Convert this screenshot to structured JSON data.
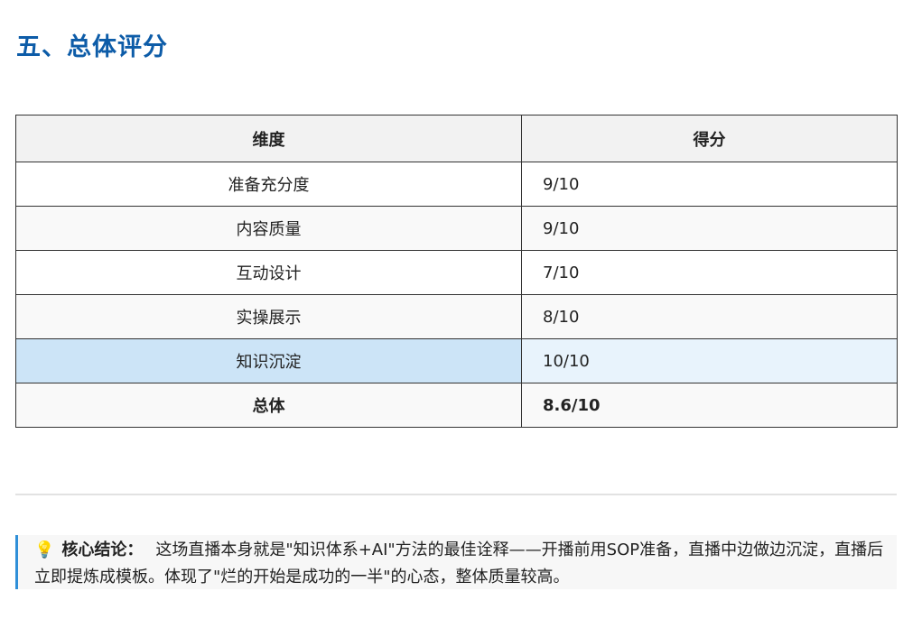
{
  "section": {
    "title": "五、总体评分"
  },
  "table": {
    "headers": [
      "维度",
      "得分"
    ],
    "rows": [
      {
        "dimension": "准备充分度",
        "score": "9/10"
      },
      {
        "dimension": "内容质量",
        "score": "9/10"
      },
      {
        "dimension": "互动设计",
        "score": "7/10"
      },
      {
        "dimension": "实操展示",
        "score": "8/10"
      },
      {
        "dimension": "知识沉淀",
        "score": "10/10"
      },
      {
        "dimension": "总体",
        "score": "8.6/10"
      }
    ]
  },
  "conclusion": {
    "icon": "lightbulb-icon",
    "label": "核心结论：",
    "text": "这场直播本身就是\"知识体系+AI\"方法的最佳诠释——开播前用SOP准备，直播中边做边沉淀，直播后立即提炼成模板。体现了\"烂的开始是成功的一半\"的心态，整体质量较高。"
  },
  "colors": {
    "title": "#0d5ca8",
    "highlight_row": "#cce4f7",
    "highlight_cell": "#e8f3fc",
    "quote_border": "#2f8fd8"
  }
}
